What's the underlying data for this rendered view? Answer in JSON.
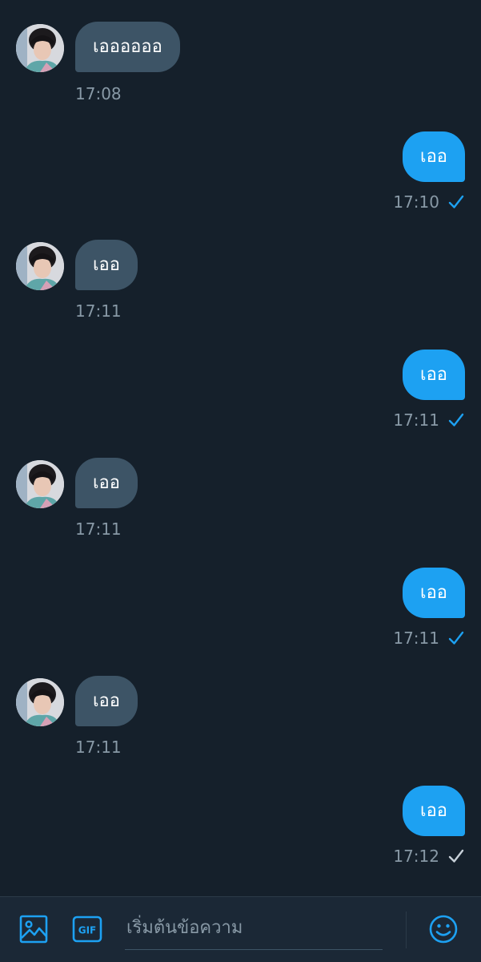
{
  "colors": {
    "background": "#15202b",
    "incoming_bubble": "#3d5466",
    "outgoing_bubble": "#1da1f2",
    "accent": "#1da1f2",
    "timestamp": "#8899a6"
  },
  "messages": [
    {
      "direction": "incoming",
      "text": "เออออออ",
      "time": "17:08"
    },
    {
      "direction": "outgoing",
      "text": "เออ",
      "time": "17:10",
      "status": "read-check-icon"
    },
    {
      "direction": "incoming",
      "text": "เออ",
      "time": "17:11"
    },
    {
      "direction": "outgoing",
      "text": "เออ",
      "time": "17:11",
      "status": "read-check-icon"
    },
    {
      "direction": "incoming",
      "text": "เออ",
      "time": "17:11"
    },
    {
      "direction": "outgoing",
      "text": "เออ",
      "time": "17:11",
      "status": "read-check-icon"
    },
    {
      "direction": "incoming",
      "text": "เออ",
      "time": "17:11"
    },
    {
      "direction": "outgoing",
      "text": "เออ",
      "time": "17:12",
      "status": "sent-check-icon"
    }
  ],
  "composer": {
    "image_icon": "image-icon",
    "gif_label": "GIF",
    "placeholder": "เริ่มต้นข้อความ",
    "value": "",
    "emoji_icon": "emoji-icon"
  }
}
